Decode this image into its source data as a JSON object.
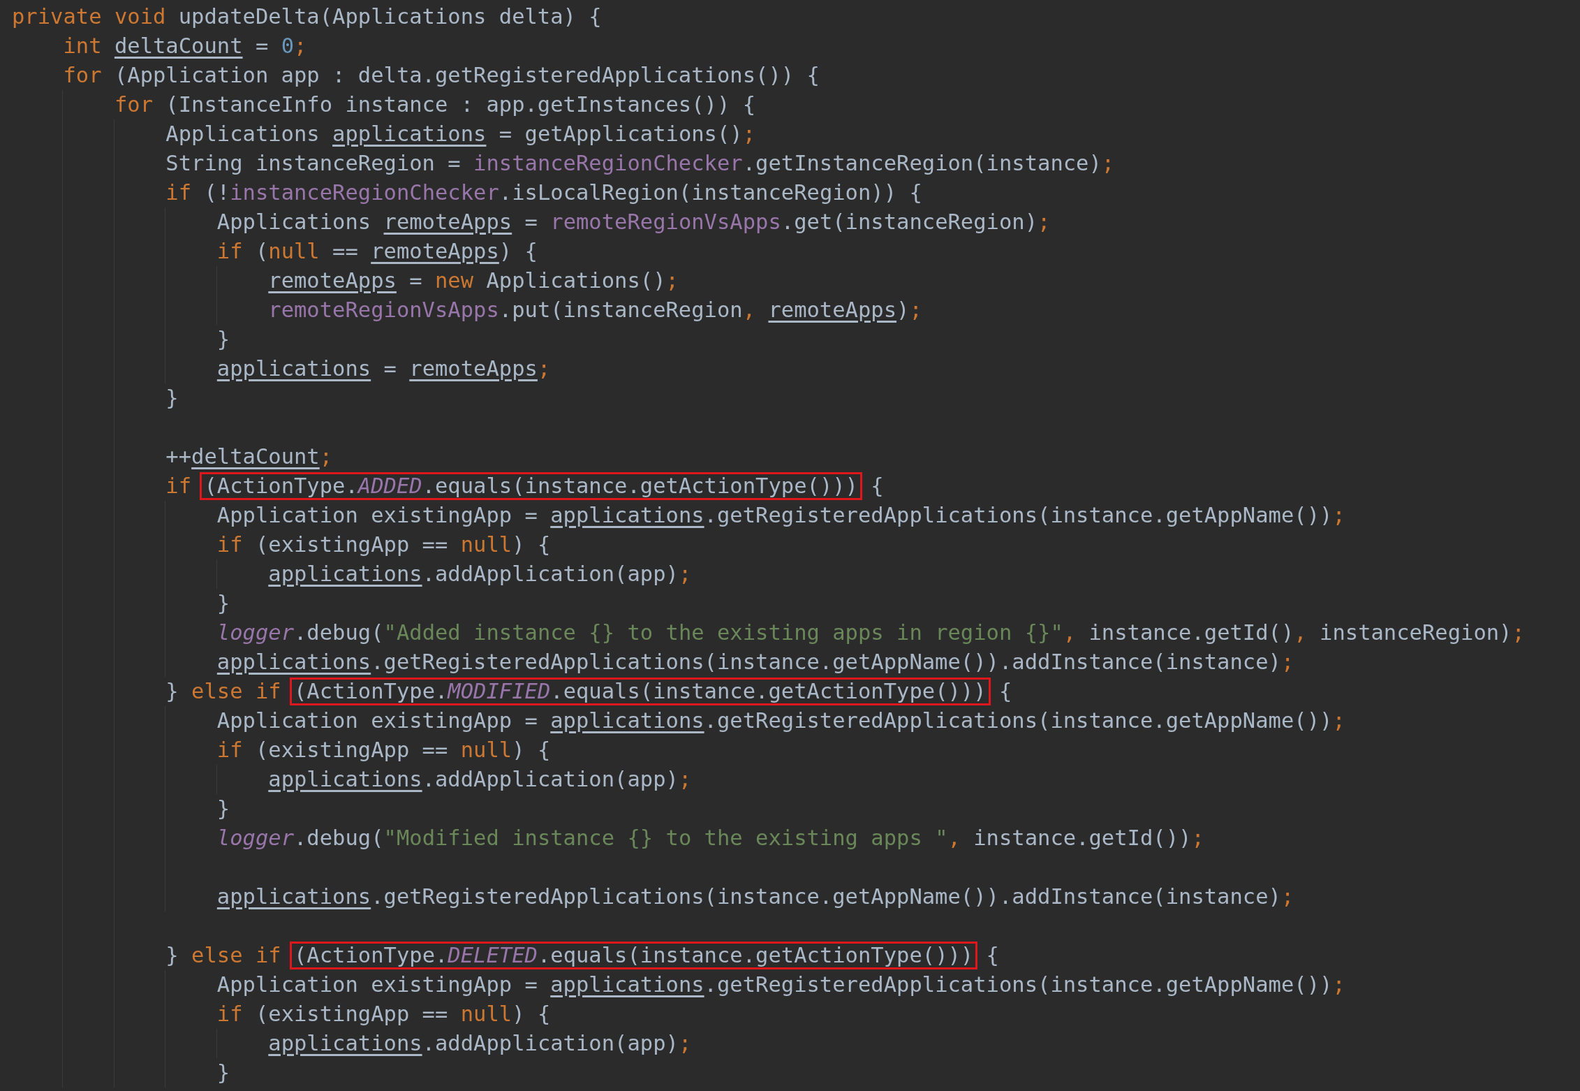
{
  "editor": {
    "lines": [
      {
        "kind": "code",
        "tokens": [
          {
            "kind": "kw",
            "text": "private void "
          },
          {
            "kind": "txt",
            "text": "updateDelta(Applications delta) {"
          }
        ],
        "children": [
          {
            "kind": "code",
            "tokens": [
              {
                "kind": "kw",
                "text": "int "
              },
              {
                "kind": "var",
                "text": "deltaCount"
              },
              {
                "kind": "txt",
                "text": " = "
              },
              {
                "kind": "num",
                "text": "0"
              },
              {
                "kind": "sep",
                "text": ";"
              }
            ]
          },
          {
            "kind": "code",
            "tokens": [
              {
                "kind": "kw",
                "text": "for "
              },
              {
                "kind": "txt",
                "text": "(Application app : delta.getRegisteredApplications()) {"
              }
            ],
            "children": [
              {
                "kind": "code",
                "tokens": [
                  {
                    "kind": "kw",
                    "text": "for "
                  },
                  {
                    "kind": "txt",
                    "text": "(InstanceInfo instance : app.getInstances()) {"
                  }
                ],
                "children": [
                  {
                    "kind": "code",
                    "tokens": [
                      {
                        "kind": "txt",
                        "text": "Applications "
                      },
                      {
                        "kind": "var",
                        "text": "applications"
                      },
                      {
                        "kind": "txt",
                        "text": " = getApplications()"
                      },
                      {
                        "kind": "sep",
                        "text": ";"
                      }
                    ]
                  },
                  {
                    "kind": "code",
                    "tokens": [
                      {
                        "kind": "txt",
                        "text": "String instanceRegion = "
                      },
                      {
                        "kind": "fld",
                        "text": "instanceRegionChecker"
                      },
                      {
                        "kind": "txt",
                        "text": ".getInstanceRegion(instance)"
                      },
                      {
                        "kind": "sep",
                        "text": ";"
                      }
                    ]
                  },
                  {
                    "kind": "code",
                    "tokens": [
                      {
                        "kind": "kw",
                        "text": "if "
                      },
                      {
                        "kind": "txt",
                        "text": "(!"
                      },
                      {
                        "kind": "fld",
                        "text": "instanceRegionChecker"
                      },
                      {
                        "kind": "txt",
                        "text": ".isLocalRegion(instanceRegion)) {"
                      }
                    ],
                    "children": [
                      {
                        "kind": "code",
                        "tokens": [
                          {
                            "kind": "txt",
                            "text": "Applications "
                          },
                          {
                            "kind": "var",
                            "text": "remoteApps"
                          },
                          {
                            "kind": "txt",
                            "text": " = "
                          },
                          {
                            "kind": "fld",
                            "text": "remoteRegionVsApps"
                          },
                          {
                            "kind": "txt",
                            "text": ".get(instanceRegion)"
                          },
                          {
                            "kind": "sep",
                            "text": ";"
                          }
                        ]
                      },
                      {
                        "kind": "code",
                        "tokens": [
                          {
                            "kind": "kw",
                            "text": "if "
                          },
                          {
                            "kind": "txt",
                            "text": "("
                          },
                          {
                            "kind": "kw",
                            "text": "null"
                          },
                          {
                            "kind": "txt",
                            "text": " == "
                          },
                          {
                            "kind": "var",
                            "text": "remoteApps"
                          },
                          {
                            "kind": "txt",
                            "text": ") {"
                          }
                        ],
                        "children": [
                          {
                            "kind": "code",
                            "tokens": [
                              {
                                "kind": "var",
                                "text": "remoteApps"
                              },
                              {
                                "kind": "txt",
                                "text": " = "
                              },
                              {
                                "kind": "kw",
                                "text": "new "
                              },
                              {
                                "kind": "txt",
                                "text": "Applications()"
                              },
                              {
                                "kind": "sep",
                                "text": ";"
                              }
                            ]
                          },
                          {
                            "kind": "code",
                            "tokens": [
                              {
                                "kind": "fld",
                                "text": "remoteRegionVsApps"
                              },
                              {
                                "kind": "txt",
                                "text": ".put(instanceRegion"
                              },
                              {
                                "kind": "sep",
                                "text": ", "
                              },
                              {
                                "kind": "var",
                                "text": "remoteApps"
                              },
                              {
                                "kind": "txt",
                                "text": ")"
                              },
                              {
                                "kind": "sep",
                                "text": ";"
                              }
                            ]
                          }
                        ]
                      },
                      {
                        "kind": "code",
                        "tokens": [
                          {
                            "kind": "txt",
                            "text": "}"
                          }
                        ]
                      },
                      {
                        "kind": "code",
                        "tokens": [
                          {
                            "kind": "var",
                            "text": "applications"
                          },
                          {
                            "kind": "txt",
                            "text": " = "
                          },
                          {
                            "kind": "var",
                            "text": "remoteApps"
                          },
                          {
                            "kind": "sep",
                            "text": ";"
                          }
                        ]
                      }
                    ]
                  },
                  {
                    "kind": "code",
                    "tokens": [
                      {
                        "kind": "txt",
                        "text": "}"
                      }
                    ]
                  },
                  {
                    "kind": "blank"
                  },
                  {
                    "kind": "code",
                    "tokens": [
                      {
                        "kind": "txt",
                        "text": "++"
                      },
                      {
                        "kind": "var",
                        "text": "deltaCount"
                      },
                      {
                        "kind": "sep",
                        "text": ";"
                      }
                    ]
                  },
                  {
                    "kind": "code",
                    "tokens": [
                      {
                        "kind": "kw",
                        "text": "if "
                      },
                      {
                        "kind": "box",
                        "tokens": [
                          {
                            "kind": "txt",
                            "text": "(ActionType."
                          },
                          {
                            "kind": "sfld",
                            "text": "ADDED"
                          },
                          {
                            "kind": "txt",
                            "text": ".equals(instance.getActionType()))"
                          }
                        ]
                      },
                      {
                        "kind": "txt",
                        "text": " {"
                      }
                    ],
                    "children": [
                      {
                        "kind": "code",
                        "tokens": [
                          {
                            "kind": "txt",
                            "text": "Application existingApp = "
                          },
                          {
                            "kind": "var",
                            "text": "applications"
                          },
                          {
                            "kind": "txt",
                            "text": ".getRegisteredApplications(instance.getAppName())"
                          },
                          {
                            "kind": "sep",
                            "text": ";"
                          }
                        ]
                      },
                      {
                        "kind": "code",
                        "tokens": [
                          {
                            "kind": "kw",
                            "text": "if "
                          },
                          {
                            "kind": "txt",
                            "text": "(existingApp == "
                          },
                          {
                            "kind": "kw",
                            "text": "null"
                          },
                          {
                            "kind": "txt",
                            "text": ") {"
                          }
                        ],
                        "children": [
                          {
                            "kind": "code",
                            "tokens": [
                              {
                                "kind": "var",
                                "text": "applications"
                              },
                              {
                                "kind": "txt",
                                "text": ".addApplication(app)"
                              },
                              {
                                "kind": "sep",
                                "text": ";"
                              }
                            ]
                          }
                        ]
                      },
                      {
                        "kind": "code",
                        "tokens": [
                          {
                            "kind": "txt",
                            "text": "}"
                          }
                        ]
                      },
                      {
                        "kind": "code",
                        "tokens": [
                          {
                            "kind": "sfld",
                            "text": "logger"
                          },
                          {
                            "kind": "txt",
                            "text": ".debug("
                          },
                          {
                            "kind": "str",
                            "text": "\"Added instance {} to the existing apps in region {}\""
                          },
                          {
                            "kind": "sep",
                            "text": ", "
                          },
                          {
                            "kind": "txt",
                            "text": "instance.getId()"
                          },
                          {
                            "kind": "sep",
                            "text": ", "
                          },
                          {
                            "kind": "txt",
                            "text": "instanceRegion)"
                          },
                          {
                            "kind": "sep",
                            "text": ";"
                          }
                        ]
                      },
                      {
                        "kind": "code",
                        "tokens": [
                          {
                            "kind": "var",
                            "text": "applications"
                          },
                          {
                            "kind": "txt",
                            "text": ".getRegisteredApplications(instance.getAppName()).addInstance(instance)"
                          },
                          {
                            "kind": "sep",
                            "text": ";"
                          }
                        ]
                      }
                    ]
                  },
                  {
                    "kind": "code",
                    "tokens": [
                      {
                        "kind": "txt",
                        "text": "} "
                      },
                      {
                        "kind": "kw",
                        "text": "else if "
                      },
                      {
                        "kind": "box",
                        "tokens": [
                          {
                            "kind": "txt",
                            "text": "(ActionType."
                          },
                          {
                            "kind": "sfld",
                            "text": "MODIFIED"
                          },
                          {
                            "kind": "txt",
                            "text": ".equals(instance.getActionType()))"
                          }
                        ]
                      },
                      {
                        "kind": "txt",
                        "text": " {"
                      }
                    ],
                    "children": [
                      {
                        "kind": "code",
                        "tokens": [
                          {
                            "kind": "txt",
                            "text": "Application existingApp = "
                          },
                          {
                            "kind": "var",
                            "text": "applications"
                          },
                          {
                            "kind": "txt",
                            "text": ".getRegisteredApplications(instance.getAppName())"
                          },
                          {
                            "kind": "sep",
                            "text": ";"
                          }
                        ]
                      },
                      {
                        "kind": "code",
                        "tokens": [
                          {
                            "kind": "kw",
                            "text": "if "
                          },
                          {
                            "kind": "txt",
                            "text": "(existingApp == "
                          },
                          {
                            "kind": "kw",
                            "text": "null"
                          },
                          {
                            "kind": "txt",
                            "text": ") {"
                          }
                        ],
                        "children": [
                          {
                            "kind": "code",
                            "tokens": [
                              {
                                "kind": "var",
                                "text": "applications"
                              },
                              {
                                "kind": "txt",
                                "text": ".addApplication(app)"
                              },
                              {
                                "kind": "sep",
                                "text": ";"
                              }
                            ]
                          }
                        ]
                      },
                      {
                        "kind": "code",
                        "tokens": [
                          {
                            "kind": "txt",
                            "text": "}"
                          }
                        ]
                      },
                      {
                        "kind": "code",
                        "tokens": [
                          {
                            "kind": "sfld",
                            "text": "logger"
                          },
                          {
                            "kind": "txt",
                            "text": ".debug("
                          },
                          {
                            "kind": "str",
                            "text": "\"Modified instance {} to the existing apps \""
                          },
                          {
                            "kind": "sep",
                            "text": ", "
                          },
                          {
                            "kind": "txt",
                            "text": "instance.getId())"
                          },
                          {
                            "kind": "sep",
                            "text": ";"
                          }
                        ]
                      },
                      {
                        "kind": "blank"
                      },
                      {
                        "kind": "code",
                        "tokens": [
                          {
                            "kind": "var",
                            "text": "applications"
                          },
                          {
                            "kind": "txt",
                            "text": ".getRegisteredApplications(instance.getAppName()).addInstance(instance)"
                          },
                          {
                            "kind": "sep",
                            "text": ";"
                          }
                        ]
                      }
                    ]
                  },
                  {
                    "kind": "blank"
                  },
                  {
                    "kind": "code",
                    "tokens": [
                      {
                        "kind": "txt",
                        "text": "} "
                      },
                      {
                        "kind": "kw",
                        "text": "else if "
                      },
                      {
                        "kind": "box",
                        "tokens": [
                          {
                            "kind": "txt",
                            "text": "(ActionType."
                          },
                          {
                            "kind": "sfld",
                            "text": "DELETED"
                          },
                          {
                            "kind": "txt",
                            "text": ".equals(instance.getActionType()))"
                          }
                        ]
                      },
                      {
                        "kind": "txt",
                        "text": " {"
                      }
                    ],
                    "children": [
                      {
                        "kind": "code",
                        "tokens": [
                          {
                            "kind": "txt",
                            "text": "Application existingApp = "
                          },
                          {
                            "kind": "var",
                            "text": "applications"
                          },
                          {
                            "kind": "txt",
                            "text": ".getRegisteredApplications(instance.getAppName())"
                          },
                          {
                            "kind": "sep",
                            "text": ";"
                          }
                        ]
                      },
                      {
                        "kind": "code",
                        "tokens": [
                          {
                            "kind": "kw",
                            "text": "if "
                          },
                          {
                            "kind": "txt",
                            "text": "(existingApp == "
                          },
                          {
                            "kind": "kw",
                            "text": "null"
                          },
                          {
                            "kind": "txt",
                            "text": ") {"
                          }
                        ],
                        "children": [
                          {
                            "kind": "code",
                            "tokens": [
                              {
                                "kind": "var",
                                "text": "applications"
                              },
                              {
                                "kind": "txt",
                                "text": ".addApplication(app)"
                              },
                              {
                                "kind": "sep",
                                "text": ";"
                              }
                            ]
                          }
                        ]
                      },
                      {
                        "kind": "code",
                        "tokens": [
                          {
                            "kind": "txt",
                            "text": "}"
                          }
                        ]
                      }
                    ]
                  }
                ]
              }
            ]
          }
        ]
      }
    ]
  }
}
